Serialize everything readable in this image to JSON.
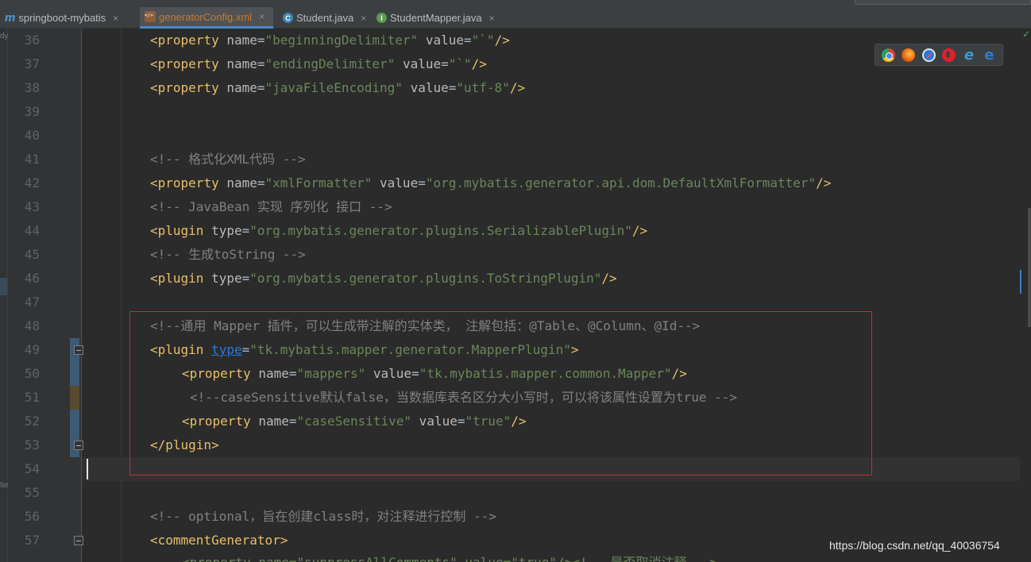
{
  "tabs": [
    {
      "label": "springboot-mybatis",
      "icon": "maven-module-icon",
      "active": false
    },
    {
      "label": "generatorConfig.xml",
      "icon": "xml-file-icon",
      "active": true
    },
    {
      "label": "Student.java",
      "icon": "java-class-icon",
      "active": false
    },
    {
      "label": "StudentMapper.java",
      "icon": "java-interface-icon",
      "active": false
    }
  ],
  "close_glyph": "×",
  "left_strip": {
    "frag1": "dy",
    "frag2": "tie"
  },
  "lines": [
    {
      "no": "36",
      "text": "beginningDelimiter-line"
    },
    {
      "no": "37"
    },
    {
      "no": "38"
    },
    {
      "no": "39"
    },
    {
      "no": "40"
    },
    {
      "no": "41"
    },
    {
      "no": "42"
    },
    {
      "no": "43"
    },
    {
      "no": "44"
    },
    {
      "no": "45"
    },
    {
      "no": "46"
    },
    {
      "no": "47"
    },
    {
      "no": "48"
    },
    {
      "no": "49"
    },
    {
      "no": "50"
    },
    {
      "no": "51"
    },
    {
      "no": "52"
    },
    {
      "no": "53"
    },
    {
      "no": "54"
    },
    {
      "no": "55"
    },
    {
      "no": "56"
    },
    {
      "no": "57"
    }
  ],
  "code": {
    "l36": {
      "tag": "property",
      "name": "beginningDelimiter",
      "value": "`"
    },
    "l37": {
      "tag": "property",
      "name": "endingDelimiter",
      "value": "`"
    },
    "l38": {
      "tag": "property",
      "name": "javaFileEncoding",
      "value": "utf-8"
    },
    "l41": "<!-- 格式化XML代码 -->",
    "l42": {
      "tag": "property",
      "name": "xmlFormatter",
      "value": "org.mybatis.generator.api.dom.DefaultXmlFormatter"
    },
    "l43": "<!-- JavaBean 实现 序列化 接口 -->",
    "l44": {
      "tag": "plugin",
      "type": "org.mybatis.generator.plugins.SerializablePlugin"
    },
    "l45": "<!-- 生成toString -->",
    "l46": {
      "tag": "plugin",
      "type": "org.mybatis.generator.plugins.ToStringPlugin"
    },
    "l48": "<!--通用 Mapper 插件，可以生成带注解的实体类， 注解包括：@Table、@Column、@Id-->",
    "l49": {
      "tag": "plugin",
      "type": "tk.mybatis.mapper.generator.MapperPlugin"
    },
    "l50": {
      "tag": "property",
      "name": "mappers",
      "value": "tk.mybatis.mapper.common.Mapper"
    },
    "l51": "<!--caseSensitive默认false，当数据库表名区分大小写时，可以将该属性设置为true -->",
    "l52": {
      "tag": "property",
      "name": "caseSensitive",
      "value": "true"
    },
    "l53": "plugin",
    "l56": "<!-- optional，旨在创建class时，对注释进行控制 -->",
    "l57": "commentGenerator",
    "l58_partial": "<property name=\"suppressAllComments\" value=\"true\"/><!-- 是否取消注释 -->"
  },
  "syntax": {
    "name_attr": "name",
    "value_attr": "value",
    "type_attr": "type"
  },
  "browser_icons": [
    "chrome-icon",
    "firefox-icon",
    "safari-icon",
    "opera-icon",
    "ie-icon",
    "edge-icon"
  ],
  "browser_glyphs": {
    "ie": "e",
    "edge": "e"
  },
  "watermark": "https://blog.csdn.net/qq_40036754",
  "colors": {
    "tag": "#e8bf6a",
    "string": "#6a8759",
    "comment": "#808080",
    "highlight_box": "#d12a2a"
  }
}
